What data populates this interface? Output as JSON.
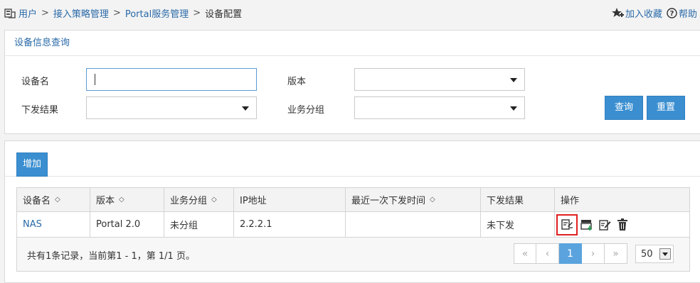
{
  "breadcrumb": {
    "items": [
      "用户",
      "接入策略管理",
      "Portal服务管理"
    ],
    "separator": ">",
    "current": "设备配置"
  },
  "top_links": {
    "favorite": "加入收藏",
    "help": "帮助"
  },
  "query_panel": {
    "title": "设备信息查询",
    "fields": {
      "device_name_label": "设备名",
      "device_name_value": "",
      "version_label": "版本",
      "version_value": "",
      "result_label": "下发结果",
      "result_value": "",
      "group_label": "业务分组",
      "group_value": ""
    },
    "query_button": "查询",
    "reset_button": "重置"
  },
  "list_panel": {
    "add_button": "增加",
    "columns": [
      "设备名",
      "版本",
      "业务分组",
      "IP地址",
      "最近一次下发时间",
      "下发结果",
      "操作"
    ],
    "rows": [
      {
        "name": "NAS",
        "version": "Portal 2.0",
        "group": "未分组",
        "ip": "2.2.2.1",
        "last_time": "",
        "result": "未下发"
      }
    ],
    "summary": "共有1条记录，当前第1 - 1，第 1/1 页。",
    "pager": {
      "first": "«",
      "prev": "‹",
      "page": "1",
      "next": "›",
      "last": "»"
    },
    "page_size": "50"
  },
  "colors": {
    "link": "#2a6aa8",
    "button": "#3b8fd0",
    "highlight": "#e02020"
  }
}
